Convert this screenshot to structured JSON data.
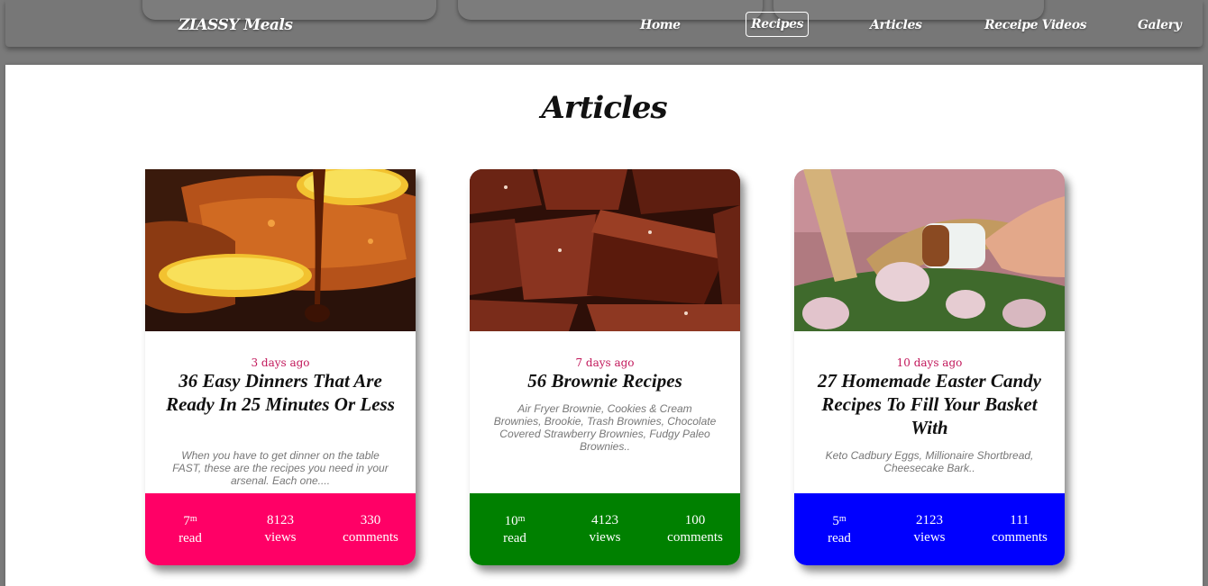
{
  "nav": {
    "brand": "ZIASSY Meals",
    "links": [
      "Home",
      "Recipes",
      "Articles",
      "Receipe Videos",
      "Galery"
    ],
    "active": "Recipes"
  },
  "page": {
    "title": "Articles"
  },
  "cards": [
    {
      "date": "3 days ago",
      "title": "36 Easy Dinners That Are Ready In 25 Minutes Or Less",
      "desc": "When you have to get dinner on the table FAST, these are the recipes you need in your arsenal. Each one....",
      "read_value": "7",
      "read_unit": "m",
      "read_label": "read",
      "views_value": "8123",
      "views_label": "views",
      "comments_value": "330",
      "comments_label": "comments",
      "accent": "#ff0066",
      "image": "glazed-salmon-photo"
    },
    {
      "date": "7 days ago",
      "title": "56 Brownie Recipes",
      "desc": "Air Fryer Brownie, Cookies & Cream Brownies, Brookie, Trash Brownies, Chocolate Covered Strawberry Brownies, Fudgy Paleo Brownies..",
      "read_value": "10",
      "read_unit": "m",
      "read_label": "read",
      "views_value": "4123",
      "views_label": "views",
      "comments_value": "100",
      "comments_label": "comments",
      "accent": "#008000",
      "image": "brownies-photo"
    },
    {
      "date": "10 days ago",
      "title": "27 Homemade Easter Candy Recipes To Fill Your Basket With",
      "desc": "Keto Cadbury Eggs, Millionaire Shortbread, Cheesecake Bark..",
      "read_value": "5",
      "read_unit": "m",
      "read_label": "read",
      "views_value": "2123",
      "views_label": "views",
      "comments_value": "111",
      "comments_label": "comments",
      "accent": "#0000ff",
      "image": "easter-candy-photo"
    }
  ]
}
